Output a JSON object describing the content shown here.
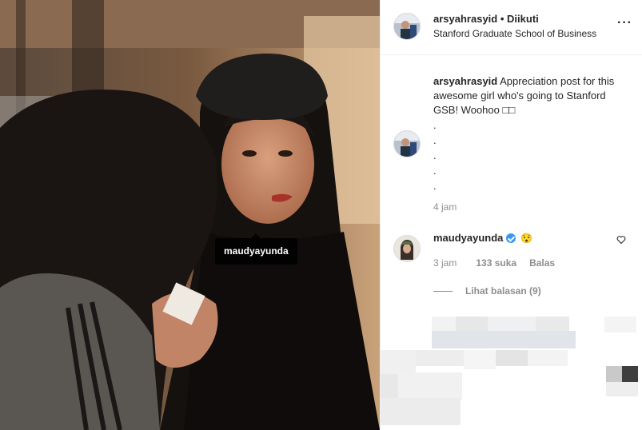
{
  "header": {
    "username": "arsyahrasyid",
    "separator": "•",
    "follow_status": "Diikuti",
    "location": "Stanford Graduate School of Business",
    "more_icon": "more-horizontal-icon"
  },
  "photo": {
    "tag_label": "maudyayunda"
  },
  "caption": {
    "username": "arsyahrasyid",
    "text": "Appreciation post for this awesome girl who's going to Stanford GSB! Woohoo □□",
    "dots": ".\n.\n.\n.\n.",
    "time": "4 jam"
  },
  "comment": {
    "username": "maudyayunda",
    "verified_icon": "verified-badge-icon",
    "emoji": "😯",
    "time": "3 jam",
    "likes": "133 suka",
    "reply_label": "Balas",
    "heart_icon": "heart-outline-icon",
    "view_replies": "Lihat balasan (9)"
  },
  "colors": {
    "muted": "#8e8e8e",
    "border": "#efefef",
    "verified": "#3897f0",
    "text": "#262626"
  }
}
